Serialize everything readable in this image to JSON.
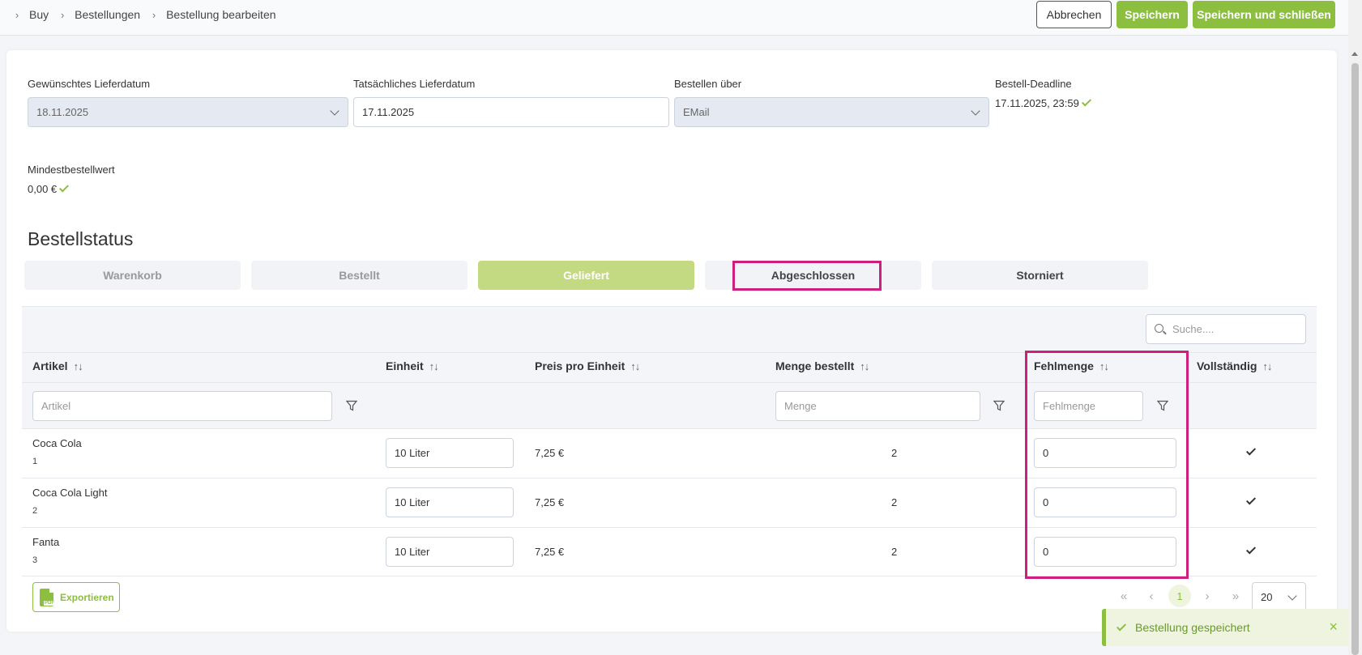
{
  "breadcrumb": {
    "items": [
      "Buy",
      "Bestellungen",
      "Bestellung bearbeiten"
    ]
  },
  "header": {
    "cancel_label": "Abbrechen",
    "save_label": "Speichern",
    "save_close_label": "Speichern und schließen"
  },
  "details": {
    "desired_date_label": "Gewünschtes Lieferdatum",
    "desired_date_value": "18.11.2025",
    "actual_date_label": "Tatsächliches Lieferdatum",
    "actual_date_value": "17.11.2025",
    "order_via_label": "Bestellen über",
    "order_via_value": "EMail",
    "deadline_label": "Bestell-Deadline",
    "deadline_value": "17.11.2025, 23:59",
    "min_value_label": "Mindestbestellwert",
    "min_value_value": "0,00 €"
  },
  "status": {
    "title": "Bestellstatus",
    "tabs": [
      "Warenkorb",
      "Bestellt",
      "Geliefert",
      "Abgeschlossen",
      "Storniert"
    ],
    "active": "Geliefert"
  },
  "table": {
    "search_placeholder": "Suche....",
    "columns": [
      "Artikel",
      "Einheit",
      "Preis pro Einheit",
      "Menge bestellt",
      "Fehlmenge",
      "Vollständig"
    ],
    "filters": {
      "artikel_placeholder": "Artikel",
      "menge_placeholder": "Menge",
      "fehlmenge_placeholder": "Fehlmenge"
    },
    "rows": [
      {
        "name": "Coca Cola",
        "id": "1",
        "unit": "10 Liter",
        "price": "7,25 €",
        "qty": "2",
        "missing": "0",
        "complete": true
      },
      {
        "name": "Coca Cola Light",
        "id": "2",
        "unit": "10 Liter",
        "price": "7,25 €",
        "qty": "2",
        "missing": "0",
        "complete": true
      },
      {
        "name": "Fanta",
        "id": "3",
        "unit": "10 Liter",
        "price": "7,25 €",
        "qty": "2",
        "missing": "0",
        "complete": true
      }
    ]
  },
  "footer": {
    "export_label": "Exportieren",
    "pdf_badge": "PDF",
    "current_page": "1",
    "page_size": "20",
    "pager_symbols": {
      "first": "«",
      "prev": "‹",
      "next": "›",
      "last": "»"
    }
  },
  "toast": {
    "message": "Bestellung gespeichert",
    "close_symbol": "×"
  },
  "colors": {
    "accent": "#8cbf3f",
    "highlight": "#cc1f7e",
    "active_tab": "#c3da82"
  }
}
